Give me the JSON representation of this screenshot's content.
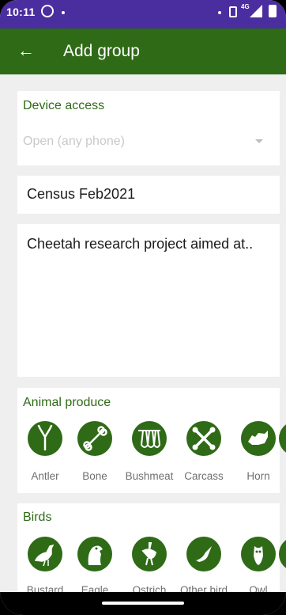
{
  "status_bar": {
    "time": "10:11",
    "network": "4G",
    "icons": [
      "whatsapp-icon",
      "vibrate-icon",
      "signal-icon",
      "battery-icon"
    ]
  },
  "app_bar": {
    "back_icon": "arrow-left-icon",
    "back_glyph": "←",
    "title": "Add group",
    "color": "#2f6a17"
  },
  "device_access": {
    "label": "Device access",
    "selected_value": "Open (any phone)"
  },
  "group_name": {
    "value": "Census Feb2021"
  },
  "description": {
    "value": "Cheetah research project aimed at.."
  },
  "animal_produce": {
    "label": "Animal produce",
    "items": [
      {
        "label": "Antler",
        "icon": "antler-icon"
      },
      {
        "label": "Bone",
        "icon": "bone-icon"
      },
      {
        "label": "Bushmeat",
        "icon": "bushmeat-icon"
      },
      {
        "label": "Carcass",
        "icon": "carcass-icon"
      },
      {
        "label": "Horn",
        "icon": "horn-icon"
      }
    ]
  },
  "birds": {
    "label": "Birds",
    "items": [
      {
        "label": "Bustard",
        "icon": "bustard-icon"
      },
      {
        "label": "Eagle",
        "icon": "eagle-icon"
      },
      {
        "label": "Ostrich",
        "icon": "ostrich-icon"
      },
      {
        "label": "Other bird",
        "icon": "other-bird-icon"
      },
      {
        "label": "Owl",
        "icon": "owl-icon"
      }
    ]
  },
  "colors": {
    "accent": "#2f6a17",
    "status_bar": "#4a2ea0",
    "placeholder_text": "#c9c9c9",
    "icon_label": "#6f6f6f"
  }
}
